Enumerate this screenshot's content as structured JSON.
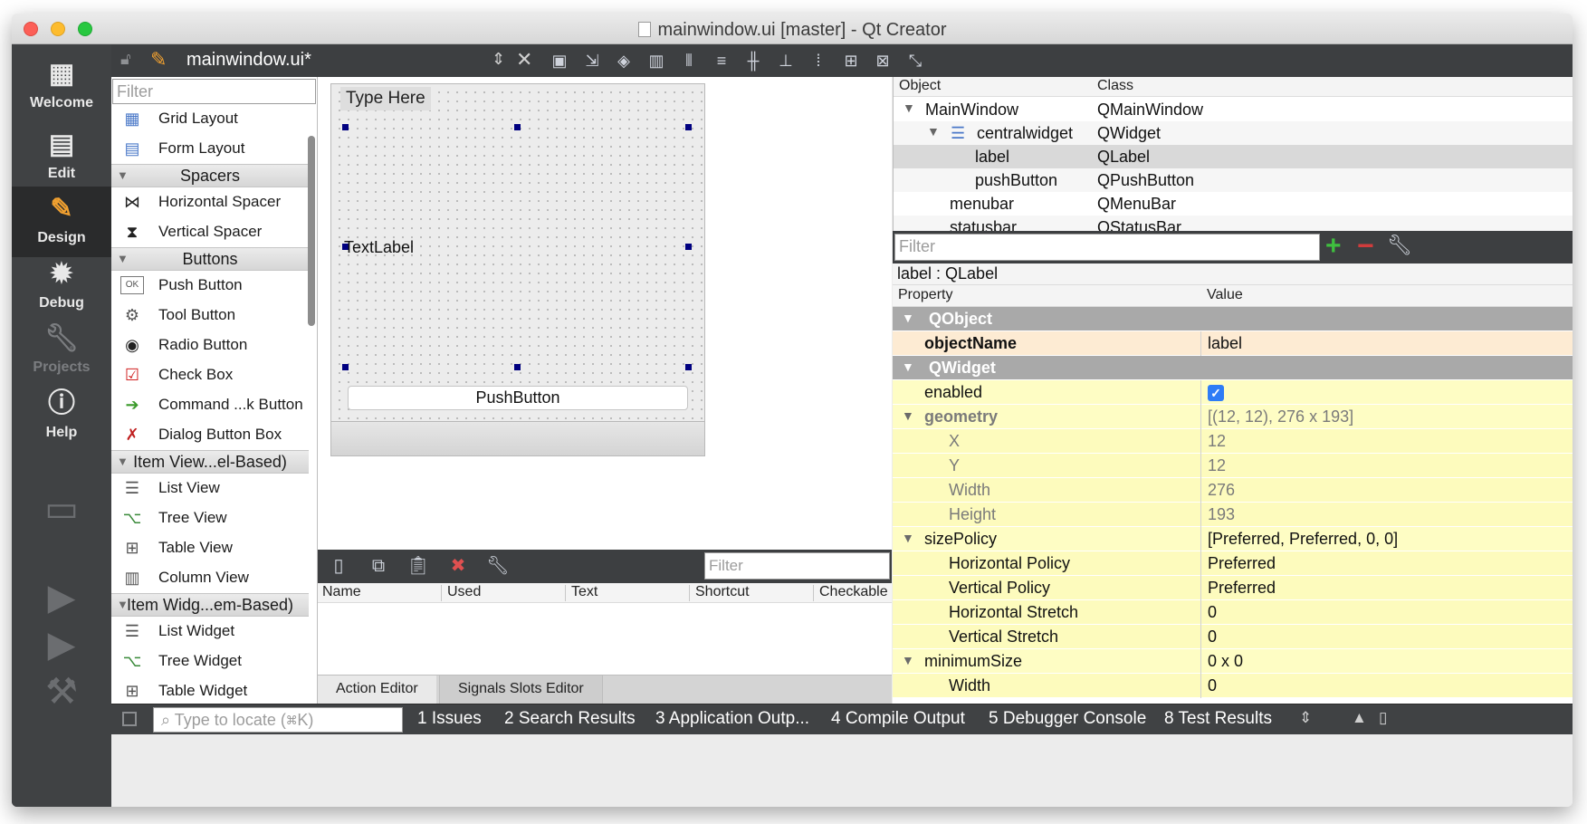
{
  "window": {
    "title": "mainwindow.ui [master] - Qt Creator"
  },
  "modes": [
    {
      "label": "Welcome",
      "icon": "grid-icon"
    },
    {
      "label": "Edit",
      "icon": "document-icon"
    },
    {
      "label": "Design",
      "icon": "pencil-icon"
    },
    {
      "label": "Debug",
      "icon": "bug-icon"
    },
    {
      "label": "Projects",
      "icon": "wrench-icon"
    },
    {
      "label": "Help",
      "icon": "help-icon"
    }
  ],
  "editor_toolbar": {
    "file_name": "mainwindow.ui*"
  },
  "widget_box": {
    "filter_placeholder": "Filter",
    "items": [
      {
        "label": "Grid Layout"
      },
      {
        "label": "Form Layout"
      },
      {
        "category": "Spacers"
      },
      {
        "label": "Horizontal Spacer"
      },
      {
        "label": "Vertical Spacer"
      },
      {
        "category": "Buttons"
      },
      {
        "label": "Push Button"
      },
      {
        "label": "Tool Button"
      },
      {
        "label": "Radio Button"
      },
      {
        "label": "Check Box"
      },
      {
        "label": "Command ...k Button"
      },
      {
        "label": "Dialog Button Box"
      },
      {
        "category": "Item View...el-Based)"
      },
      {
        "label": "List View"
      },
      {
        "label": "Tree View"
      },
      {
        "label": "Table View"
      },
      {
        "label": "Column View"
      },
      {
        "category": "Item Widg...em-Based)"
      },
      {
        "label": "List Widget"
      },
      {
        "label": "Tree Widget"
      },
      {
        "label": "Table Widget"
      }
    ]
  },
  "form": {
    "menu_placeholder": "Type Here",
    "label_text": "TextLabel",
    "button_text": "PushButton"
  },
  "action_editor": {
    "filter_placeholder": "Filter",
    "columns": [
      "Name",
      "Used",
      "Text",
      "Shortcut",
      "Checkable"
    ],
    "tabs": [
      "Action Editor",
      "Signals  Slots Editor"
    ]
  },
  "object_inspector": {
    "columns": [
      "Object",
      "Class"
    ],
    "rows": [
      {
        "object": "MainWindow",
        "class": "QMainWindow"
      },
      {
        "object": "centralwidget",
        "class": "QWidget"
      },
      {
        "object": "label",
        "class": "QLabel"
      },
      {
        "object": "pushButton",
        "class": "QPushButton"
      },
      {
        "object": "menubar",
        "class": "QMenuBar"
      },
      {
        "object": "statusbar",
        "class": "QStatusBar"
      }
    ]
  },
  "property_editor": {
    "filter_placeholder": "Filter",
    "caption": "label : QLabel",
    "columns": [
      "Property",
      "Value"
    ],
    "rows": [
      {
        "name": "QObject",
        "value": ""
      },
      {
        "name": "objectName",
        "value": "label"
      },
      {
        "name": "QWidget",
        "value": ""
      },
      {
        "name": "enabled",
        "value": ""
      },
      {
        "name": "geometry",
        "value": "[(12, 12), 276 x 193]"
      },
      {
        "name": "X",
        "value": "12"
      },
      {
        "name": "Y",
        "value": "12"
      },
      {
        "name": "Width",
        "value": "276"
      },
      {
        "name": "Height",
        "value": "193"
      },
      {
        "name": "sizePolicy",
        "value": "[Preferred, Preferred, 0, 0]"
      },
      {
        "name": "Horizontal Policy",
        "value": "Preferred"
      },
      {
        "name": "Vertical Policy",
        "value": "Preferred"
      },
      {
        "name": "Horizontal Stretch",
        "value": "0"
      },
      {
        "name": "Vertical Stretch",
        "value": "0"
      },
      {
        "name": "minimumSize",
        "value": "0 x 0"
      },
      {
        "name": "Width",
        "value": "0"
      }
    ],
    "enabled_checked": true
  },
  "status_bar": {
    "locate_placeholder": "Type to locate (⌘K)",
    "tabs": [
      "1  Issues",
      "2  Search Results",
      "3  Application Outp...",
      "4  Compile Output",
      "5  Debugger Console",
      "8  Test Results"
    ]
  }
}
